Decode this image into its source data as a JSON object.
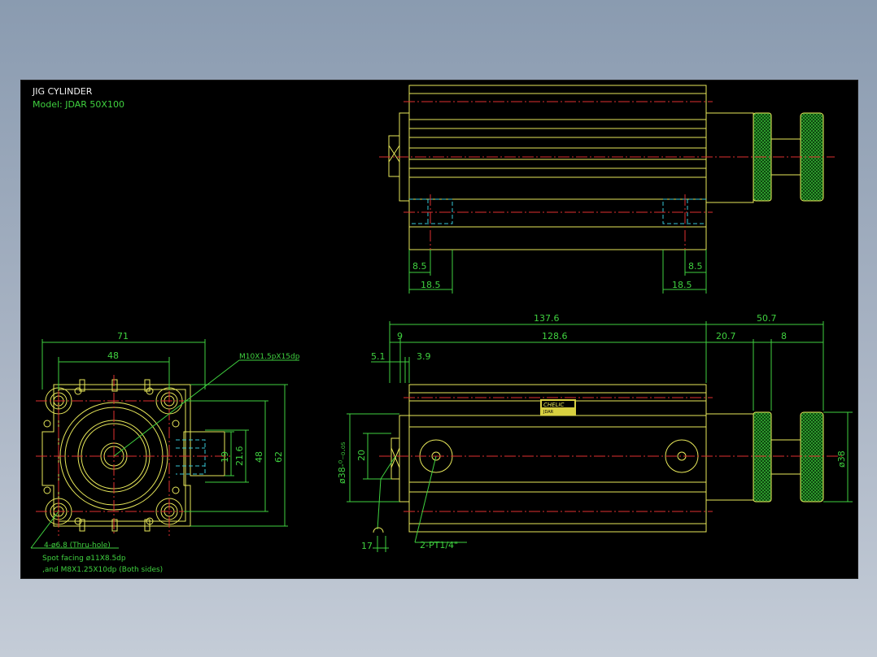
{
  "title_block": {
    "title": "JIG CYLINDER",
    "model": "Model:  JDAR  50X100"
  },
  "dimensions": {
    "top_view": [
      "8.5",
      "18.5",
      "8.5",
      "18.5"
    ],
    "front_view": {
      "overall_length": "137.6",
      "rod_extension": "50.7",
      "head_offset": "9",
      "body_length": "128.6",
      "rod_nut": "20.7",
      "nut_width": "8",
      "left_a": "5.1",
      "left_b": "3.9",
      "port_height": "20",
      "bore_dia": "ø38-⁰₋₀.₀₅",
      "rod_dia": "ø38",
      "bottom_gap": "17",
      "port_label": "2-PT1/4\""
    },
    "end_view": {
      "width": "71",
      "pitch": "48",
      "thread": "M10X1.5pX15dp",
      "h19": "19",
      "h21": "21.6",
      "h48": "48",
      "h62": "62"
    }
  },
  "notes": {
    "hole": "4-ø6.8 (Thru-hole)",
    "spot": "Spot facing  ø11X8.5dp",
    "tap": ",and M8X1.25X10dp (Both sides)"
  },
  "label_plate": {
    "brand": "CHELIC",
    "line2": "JDAR"
  },
  "colors": {
    "background": "#000000",
    "outline": "#e8e85a",
    "dimension": "#3fd13f",
    "centerline": "#e03030",
    "hidden": "#36c6d6"
  }
}
